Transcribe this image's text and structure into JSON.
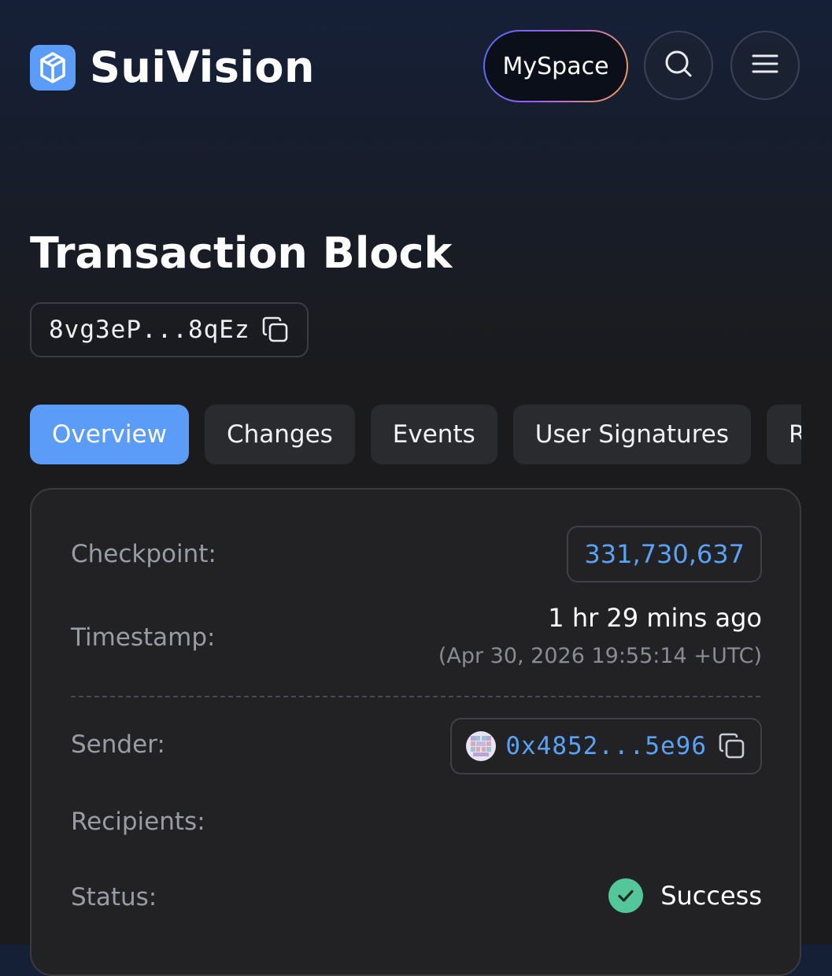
{
  "header": {
    "brand_name": "SuiVision",
    "myspace_label": "MySpace",
    "search_icon": "search-icon",
    "menu_icon": "hamburger-menu-icon"
  },
  "page": {
    "title": "Transaction Block",
    "tx_hash": "8vg3eP...8qEz"
  },
  "tabs": [
    {
      "label": "Overview",
      "active": true
    },
    {
      "label": "Changes",
      "active": false
    },
    {
      "label": "Events",
      "active": false
    },
    {
      "label": "User Signatures",
      "active": false
    },
    {
      "label": "Ra",
      "active": false
    }
  ],
  "overview": {
    "checkpoint": {
      "label": "Checkpoint:",
      "value": "331,730,637"
    },
    "timestamp": {
      "label": "Timestamp:",
      "relative": "1 hr 29 mins ago",
      "absolute": "(Apr 30, 2026 19:55:14 +UTC)"
    },
    "sender": {
      "label": "Sender:",
      "value": "0x4852...5e96"
    },
    "recipients": {
      "label": "Recipients:"
    },
    "status": {
      "label": "Status:",
      "value": "Success"
    }
  },
  "colors": {
    "accent": "#5a9cf8",
    "link": "#5aa2f6",
    "success": "#54c79a",
    "background": "#1b1b1d",
    "card": "#222224"
  }
}
